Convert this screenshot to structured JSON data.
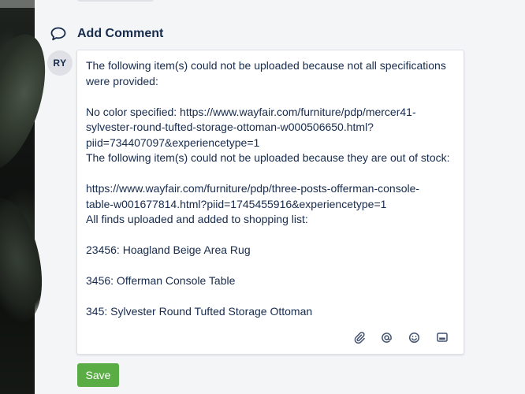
{
  "header": {
    "title": "Add Comment",
    "icon": "comment-icon"
  },
  "avatar": {
    "initials": "RY"
  },
  "comment": {
    "lines": [
      "The following item(s) could not be uploaded because not all specifications",
      "were provided:",
      "",
      "No color specified: https://www.wayfair.com/furniture/pdp/mercer41-",
      "sylvester-round-tufted-storage-ottoman-w000506650.html?",
      "piid=734407097&experiencetype=1",
      "The following item(s) could not be uploaded because they are out of stock:",
      "",
      "https://www.wayfair.com/furniture/pdp/three-posts-offerman-console-",
      "table-w001677814.html?piid=1745455916&experiencetype=1",
      "All finds uploaded and added to shopping list:",
      "",
      "23456: Hoagland Beige Area Rug",
      "",
      "3456: Offerman Console Table",
      "",
      "345: Sylvester Round Tufted Storage Ottoman"
    ]
  },
  "toolbar": {
    "icons": [
      "paperclip-icon",
      "mention-icon",
      "emoji-icon",
      "card-icon"
    ]
  },
  "actions": {
    "save_label": "Save"
  },
  "colors": {
    "accent": "#5aac44",
    "text": "#172b4d",
    "icon": "#42526e"
  }
}
